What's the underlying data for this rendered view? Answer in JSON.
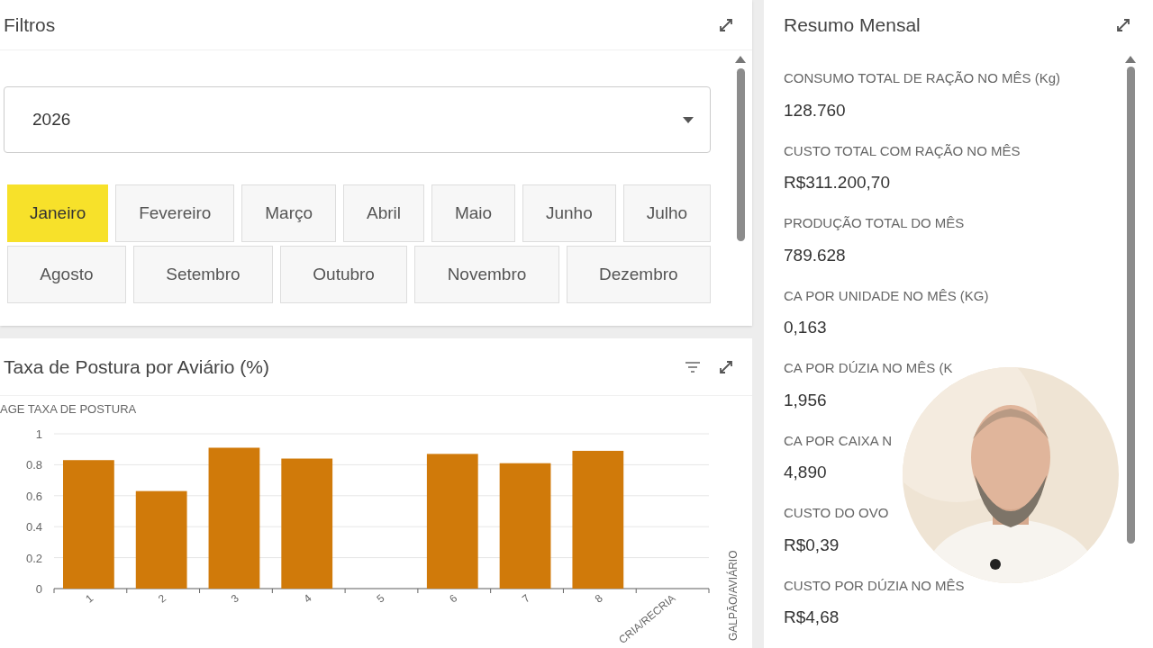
{
  "filters": {
    "title": "Filtros",
    "year": {
      "value": "2026"
    },
    "month_rows": [
      {
        "months": [
          {
            "label": "Janeiro",
            "selected": true
          },
          {
            "label": "Fevereiro",
            "selected": false
          },
          {
            "label": "Março",
            "selected": false
          },
          {
            "label": "Abril",
            "selected": false
          },
          {
            "label": "Maio",
            "selected": false
          },
          {
            "label": "Junho",
            "selected": false
          },
          {
            "label": "Julho",
            "selected": false
          }
        ]
      },
      {
        "months": [
          {
            "label": "Agosto",
            "selected": false
          },
          {
            "label": "Setembro",
            "selected": false
          },
          {
            "label": "Outubro",
            "selected": false
          },
          {
            "label": "Novembro",
            "selected": false
          },
          {
            "label": "Dezembro",
            "selected": false
          }
        ]
      }
    ]
  },
  "chart_panel": {
    "title": "Taxa de Postura por Aviário (%)",
    "chart_data": {
      "type": "bar",
      "grid": true,
      "annotations": [
        {
          "text": "GALPÃO/AVIÁRIO"
        }
      ],
      "ylabel": "AGE TAXA DE POSTURA",
      "categories": [
        "1",
        "2",
        "3",
        "4",
        "5",
        "6",
        "7",
        "8",
        "CRIA/RECRIA"
      ],
      "series": [
        {
          "color": "#d07a0a",
          "values": [
            0.83,
            0.63,
            0.91,
            0.84,
            null,
            0.87,
            0.81,
            0.89,
            null
          ]
        }
      ],
      "ylim": [
        0,
        1
      ],
      "yticks": [
        {
          "value": 0,
          "label": "0"
        },
        {
          "value": 0.2,
          "label": "0.2"
        },
        {
          "value": 0.4,
          "label": "0.4"
        },
        {
          "value": 0.6,
          "label": "0.6"
        },
        {
          "value": 0.8,
          "label": "0.8"
        },
        {
          "value": 1,
          "label": "1"
        }
      ]
    }
  },
  "summary": {
    "title": "Resumo Mensal",
    "items": [
      {
        "label": "CONSUMO TOTAL DE RAÇÃO NO MÊS (Kg)",
        "value": "128.760"
      },
      {
        "label": "CUSTO TOTAL COM RAÇÃO NO MÊS",
        "value": "R$311.200,70"
      },
      {
        "label": "PRODUÇÃO TOTAL DO MÊS",
        "value": "789.628"
      },
      {
        "label": "CA POR UNIDADE NO MÊS (KG)",
        "value": "0,163"
      },
      {
        "label": "CA POR DÚZIA NO MÊS (K",
        "value": "1,956"
      },
      {
        "label": "CA POR CAIXA N",
        "value": "4,890"
      },
      {
        "label": "CUSTO DO OVO",
        "value": "R$0,39"
      },
      {
        "label": "CUSTO POR DÚZIA NO MÊS",
        "value": "R$4,68"
      }
    ]
  }
}
